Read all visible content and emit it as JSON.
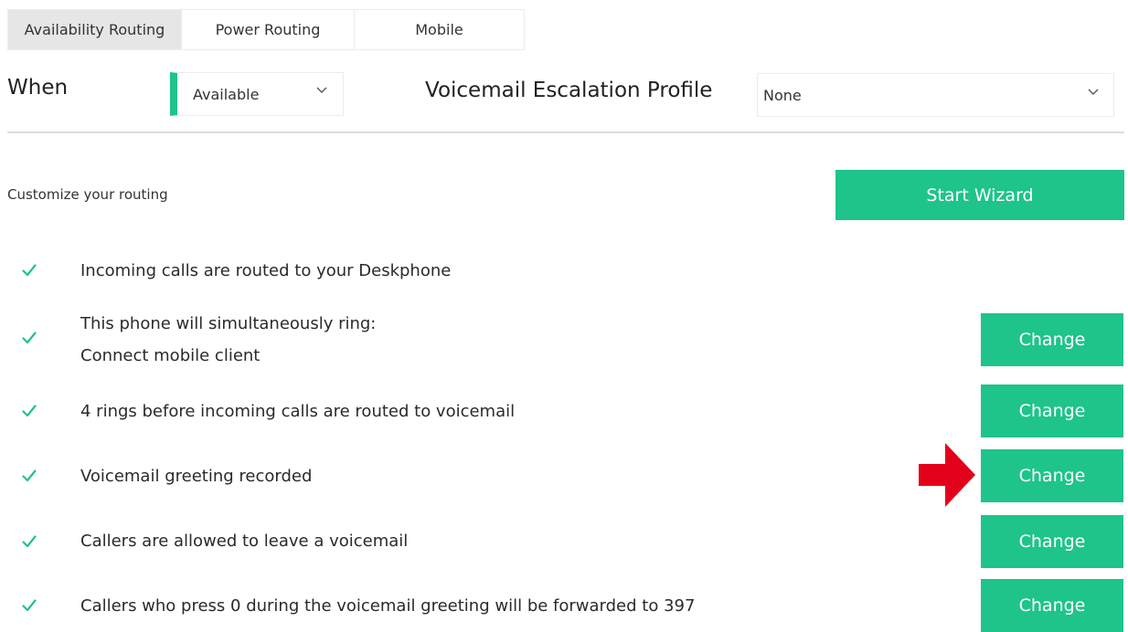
{
  "tabs": [
    {
      "label": "Availability Routing",
      "active": true
    },
    {
      "label": "Power Routing",
      "active": false
    },
    {
      "label": "Mobile",
      "active": false
    }
  ],
  "when": {
    "label": "When",
    "status_value": "Available",
    "status_color": "#1ec48a"
  },
  "escalation": {
    "label": "Voicemail Escalation Profile",
    "value": "None"
  },
  "customize": {
    "label": "Customize your routing",
    "wizard_button": "Start Wizard"
  },
  "rules": [
    {
      "line1": "Incoming calls are routed to your Deskphone",
      "line2": "",
      "has_change": false
    },
    {
      "line1": "This phone will simultaneously ring:",
      "line2": "Connect mobile client",
      "has_change": true
    },
    {
      "line1": "4 rings before incoming calls are routed to voicemail",
      "line2": "",
      "has_change": true
    },
    {
      "line1": "Voicemail greeting recorded",
      "line2": "",
      "has_change": true
    },
    {
      "line1": "Callers are allowed to leave a voicemail",
      "line2": "",
      "has_change": true
    },
    {
      "line1": "Callers who press 0 during the voicemail greeting will be forwarded to 397",
      "line2": "",
      "has_change": true
    }
  ],
  "change_label": "Change",
  "icons": {
    "check": "check-icon",
    "chevron": "chevron-down-icon",
    "pointer": "red-arrow-icon"
  },
  "colors": {
    "accent": "#1ec48a",
    "arrow": "#e3001b"
  }
}
